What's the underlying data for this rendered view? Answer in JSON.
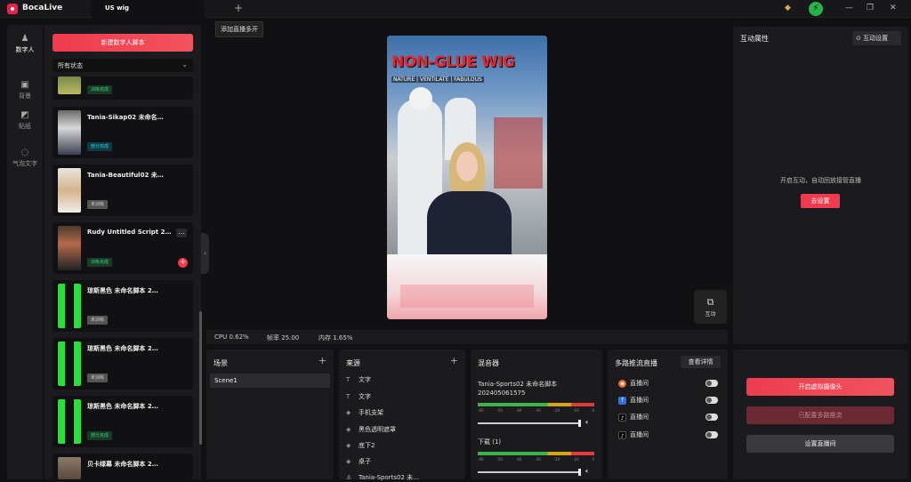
{
  "app": {
    "name": "BocaLive",
    "tab": "US wig",
    "new_tab_tooltip": "添加直播多开"
  },
  "nav": [
    {
      "label": "数字人",
      "icon": "person-icon"
    },
    {
      "label": "背景",
      "icon": "image-icon"
    },
    {
      "label": "贴纸",
      "icon": "sticker-icon"
    },
    {
      "label": "气泡文字",
      "icon": "bubble-icon"
    }
  ],
  "scripts": {
    "new_button": "新建数字人脚本",
    "filter": "所有状态",
    "cards": [
      {
        "title": "",
        "badge": "训练完成",
        "badge_type": "green"
      },
      {
        "title": "Tania-Sikap02 未命名…",
        "badge": "部分完成",
        "badge_type": "cyan"
      },
      {
        "title": "Tania-Beautiful02 未…",
        "badge": "未训练",
        "badge_type": "gray"
      },
      {
        "title": "Rudy Untitled Script 2…",
        "badge": "训练完成",
        "badge_type": "green"
      },
      {
        "title": "琼斯黑色 未命名脚本 2…",
        "badge": "未训练",
        "badge_type": "gray"
      },
      {
        "title": "琼斯黑色 未命名脚本 2…",
        "badge": "未训练",
        "badge_type": "gray"
      },
      {
        "title": "琼斯黑色 未命名脚本 2…",
        "badge": "部分完成",
        "badge_type": "green"
      },
      {
        "title": "贝卡绿幕 未命名脚本 2…",
        "badge": "",
        "badge_type": ""
      }
    ]
  },
  "preview": {
    "headline": "NON-GLUE WIG",
    "subline": "NATURE | VENTILATE | FABULOUS",
    "interact_label": "互动"
  },
  "stats": {
    "cpu": "CPU 0.62%",
    "fps": "帧率 25.00",
    "mem": "内存 1.65%"
  },
  "interaction": {
    "title": "互动属性",
    "settings_button": "互动设置",
    "message": "开启互动，自动回放接管直播",
    "go_button": "去设置"
  },
  "scene": {
    "title": "场景",
    "items": [
      "Scene1"
    ]
  },
  "source": {
    "title": "来源",
    "items": [
      {
        "icon": "text-icon",
        "glyph": "T",
        "label": "文字"
      },
      {
        "icon": "text-icon",
        "glyph": "T",
        "label": "文字"
      },
      {
        "icon": "layer-icon",
        "glyph": "◈",
        "label": "手机支架"
      },
      {
        "icon": "layer-icon",
        "glyph": "◈",
        "label": "黑色透明遮罩"
      },
      {
        "icon": "layer-icon",
        "glyph": "◈",
        "label": "底下2"
      },
      {
        "icon": "layer-icon",
        "glyph": "◈",
        "label": "桌子"
      },
      {
        "icon": "person-icon",
        "glyph": "♙",
        "label": "Tania-Sports02 未…"
      }
    ]
  },
  "mixer": {
    "title": "混音器",
    "track1": "Tania-Sports02 未命名脚本",
    "track1_id": "202405061575",
    "track2": "下载 (1)",
    "ticks": [
      "-60",
      "-50",
      "-40",
      "-30",
      "-20",
      "-10",
      "0"
    ]
  },
  "multistream": {
    "title": "多路推流直播",
    "detail_button": "查看详情",
    "rows": [
      {
        "label": "直播间",
        "icon": "rss-icon",
        "color": "#e8642a",
        "glyph": "◉"
      },
      {
        "label": "直播间",
        "icon": "facebook-icon",
        "color": "#2f6fe0",
        "glyph": "f"
      },
      {
        "label": "直播间",
        "icon": "tiktok-icon",
        "color": "#111111",
        "glyph": "♪"
      },
      {
        "label": "直播间",
        "icon": "tiktok-icon",
        "color": "#111111",
        "glyph": "♪"
      }
    ]
  },
  "actions": {
    "start_virtual_cam": "开启虚拟摄像头",
    "multi_stream": "已配置多路推流",
    "set_live_room": "设置直播间"
  },
  "colors": {
    "accent": "#ef3b4f",
    "panel": "#1b1b1e",
    "bg": "#111113"
  }
}
